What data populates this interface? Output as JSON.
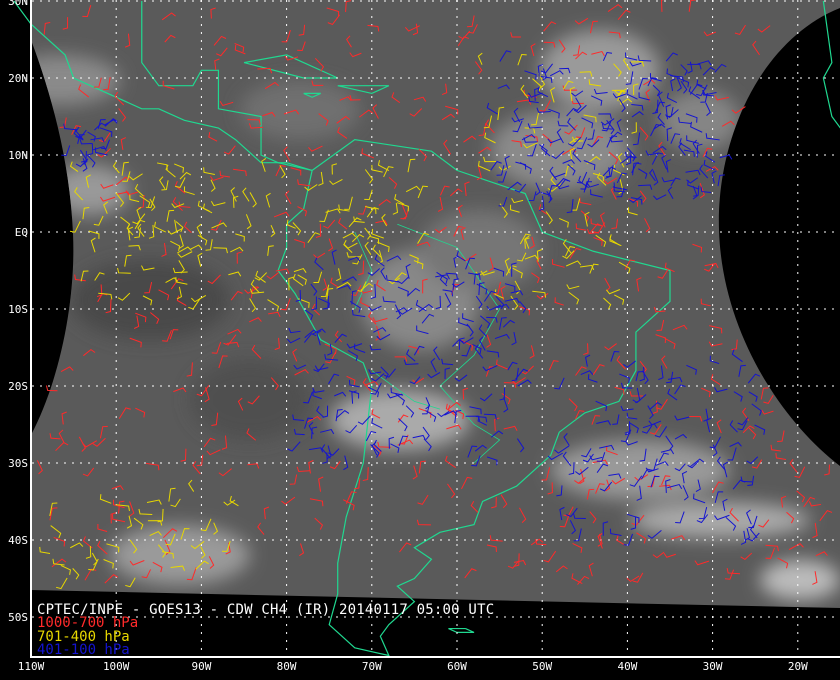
{
  "title": "CPTEC/INPE - GOES13 - CDW CH4 (IR) 20140117 05:00 UTC",
  "legend": [
    {
      "label": "1000-700 hPa",
      "color": "#ff2a2a"
    },
    {
      "label": "701-400 hPa",
      "color": "#e8d800"
    },
    {
      "label": "401-100 hPa",
      "color": "#1414d0"
    }
  ],
  "lat_labels": [
    "30N",
    "20N",
    "10N",
    "EQ",
    "10S",
    "20S",
    "30S",
    "40S",
    "50S"
  ],
  "lon_labels": [
    "110W",
    "100W",
    "90W",
    "80W",
    "70W",
    "60W",
    "50W",
    "40W",
    "30W",
    "20W"
  ],
  "colors": {
    "coast": "#20d890",
    "grid": "#ffffff",
    "background": "#000000",
    "cloud_base": "#5a5a5a"
  }
}
